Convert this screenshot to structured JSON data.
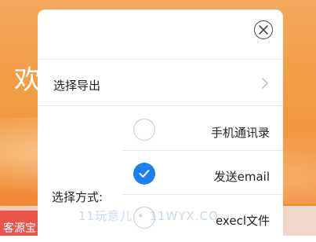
{
  "background": {
    "welcome_text": "欢",
    "banner_text": "客源宝"
  },
  "modal": {
    "export_label": "选择导出",
    "method_label": "选择方式:",
    "options": [
      {
        "label": "手机通讯录",
        "checked": false
      },
      {
        "label": "发送email",
        "checked": true
      },
      {
        "label": "execl文件",
        "checked": false
      }
    ]
  },
  "watermark": "11玩意儿 • 11WYX.CO",
  "colors": {
    "accent": "#1c7ff2",
    "background_orange": "#f39a42"
  },
  "icons": {
    "close": "close-circle-icon",
    "chevron": "chevron-right-icon",
    "check": "check-icon"
  }
}
